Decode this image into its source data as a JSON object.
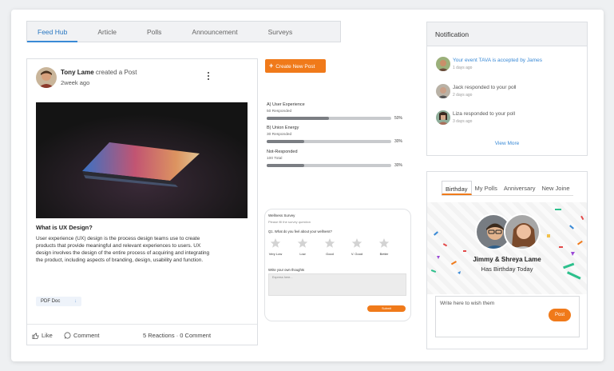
{
  "tabs": [
    "Feed Hub",
    "Article",
    "Polls",
    "Announcement",
    "Surveys"
  ],
  "post": {
    "author": "Tony Lame",
    "action": "created a Post",
    "time": "2week ago",
    "title": "What is UX Design?",
    "body": "User experience (UX) design is the process design teams use to create products that provide meaningful and relevant experiences to users. UX design involves the design of the entire process of acquiring and integrating the product, including aspects of branding, design, usability and function.",
    "attachment": "PDF Doc",
    "like_label": "Like",
    "comment_label": "Comment",
    "stats": "5 Reactions · 0 Comment"
  },
  "create_post": "Create New Post",
  "poll": [
    {
      "question": "A) User Experience",
      "responded": "50 Responded",
      "percent_label": "50%",
      "percent": 50
    },
    {
      "question": "B) Union Energy",
      "responded": "30 Responded",
      "percent_label": "30%",
      "percent": 30
    },
    {
      "question": "Not-Responded",
      "responded": "100 Total",
      "percent_label": "30%",
      "percent": 30
    }
  ],
  "survey": {
    "title": "Wellness Survey",
    "subtitle": "Please fill the survey question",
    "question": "Q1.  What do you feel about your wellness?",
    "ratings": [
      "Very Low",
      "Low",
      "Good",
      "V. Good",
      "Better"
    ],
    "write_label": "Write your own thoughts",
    "placeholder": "Express here...",
    "submit": "Submit"
  },
  "notification": {
    "header": "Notification",
    "items": [
      {
        "text": "Your event TAVA is accepted by James",
        "time": "1 days ago"
      },
      {
        "text": "Jack responded to your poll",
        "time": "2 days ago"
      },
      {
        "text": "Liza responded to your poll",
        "time": "3 days ago"
      }
    ],
    "view_more": "View More"
  },
  "birthday": {
    "tabs": [
      "Birthday",
      "My Polls",
      "Anniversary",
      "New Joine"
    ],
    "names": "Jimmy & Shreya Lame",
    "message": "Has Birthday Today",
    "wish_placeholder": "Write here to wish them",
    "post_label": "Post"
  },
  "colors": {
    "accent": "#f07a1a",
    "link": "#3a8ad6"
  }
}
